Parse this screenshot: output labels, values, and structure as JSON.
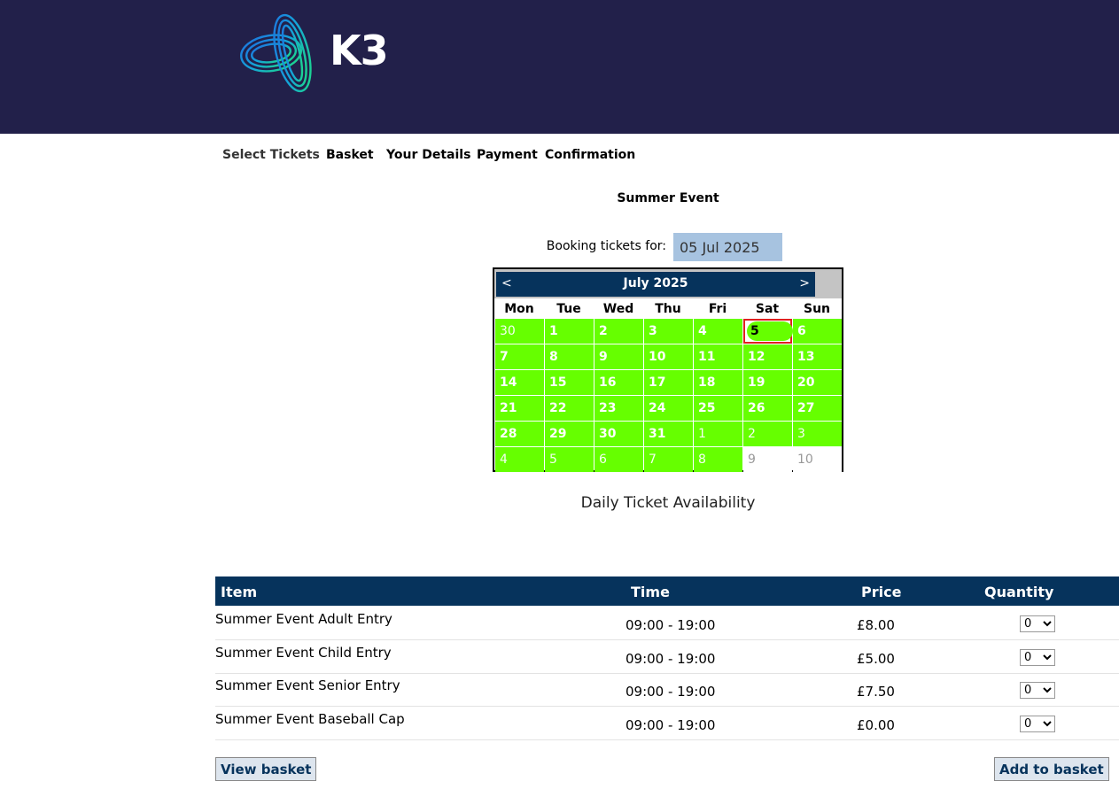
{
  "brand": {
    "name": "K3",
    "header_bg": "#22204a"
  },
  "steps": [
    "Select Tickets",
    "Basket",
    "Your Details",
    "Payment",
    "Confirmation"
  ],
  "event": {
    "title": "Summer Event"
  },
  "booking": {
    "label": "Booking tickets for:",
    "date_value": "05 Jul 2025"
  },
  "calendar": {
    "prev": "<",
    "next": ">",
    "month": "July 2025",
    "weekdays": [
      "Mon",
      "Tue",
      "Wed",
      "Thu",
      "Fri",
      "Sat",
      "Sun"
    ],
    "weeks": [
      [
        "30",
        "1",
        "2",
        "3",
        "4",
        "5",
        "6"
      ],
      [
        "7",
        "8",
        "9",
        "10",
        "11",
        "12",
        "13"
      ],
      [
        "14",
        "15",
        "16",
        "17",
        "18",
        "19",
        "20"
      ],
      [
        "21",
        "22",
        "23",
        "24",
        "25",
        "26",
        "27"
      ],
      [
        "28",
        "29",
        "30",
        "31",
        "1",
        "2",
        "3"
      ],
      [
        "4",
        "5",
        "6",
        "7",
        "8",
        "9",
        "10"
      ]
    ],
    "selected_day": "5",
    "available_color": "#66ff00"
  },
  "availability_label": "Daily Ticket Availability",
  "table": {
    "headers": {
      "item": "Item",
      "time": "Time",
      "price": "Price",
      "quantity": "Quantity"
    },
    "rows": [
      {
        "item": "Summer Event Adult Entry",
        "time": "09:00 - 19:00",
        "price": "£8.00",
        "qty": "0"
      },
      {
        "item": "Summer Event Child Entry",
        "time": "09:00 - 19:00",
        "price": "£5.00",
        "qty": "0"
      },
      {
        "item": "Summer Event Senior Entry",
        "time": "09:00 - 19:00",
        "price": "£7.50",
        "qty": "0"
      },
      {
        "item": "Summer Event Baseball Cap",
        "time": "09:00 - 19:00",
        "price": "£0.00",
        "qty": "0"
      }
    ]
  },
  "buttons": {
    "view_basket": "View basket",
    "add_to_basket": "Add to basket"
  }
}
